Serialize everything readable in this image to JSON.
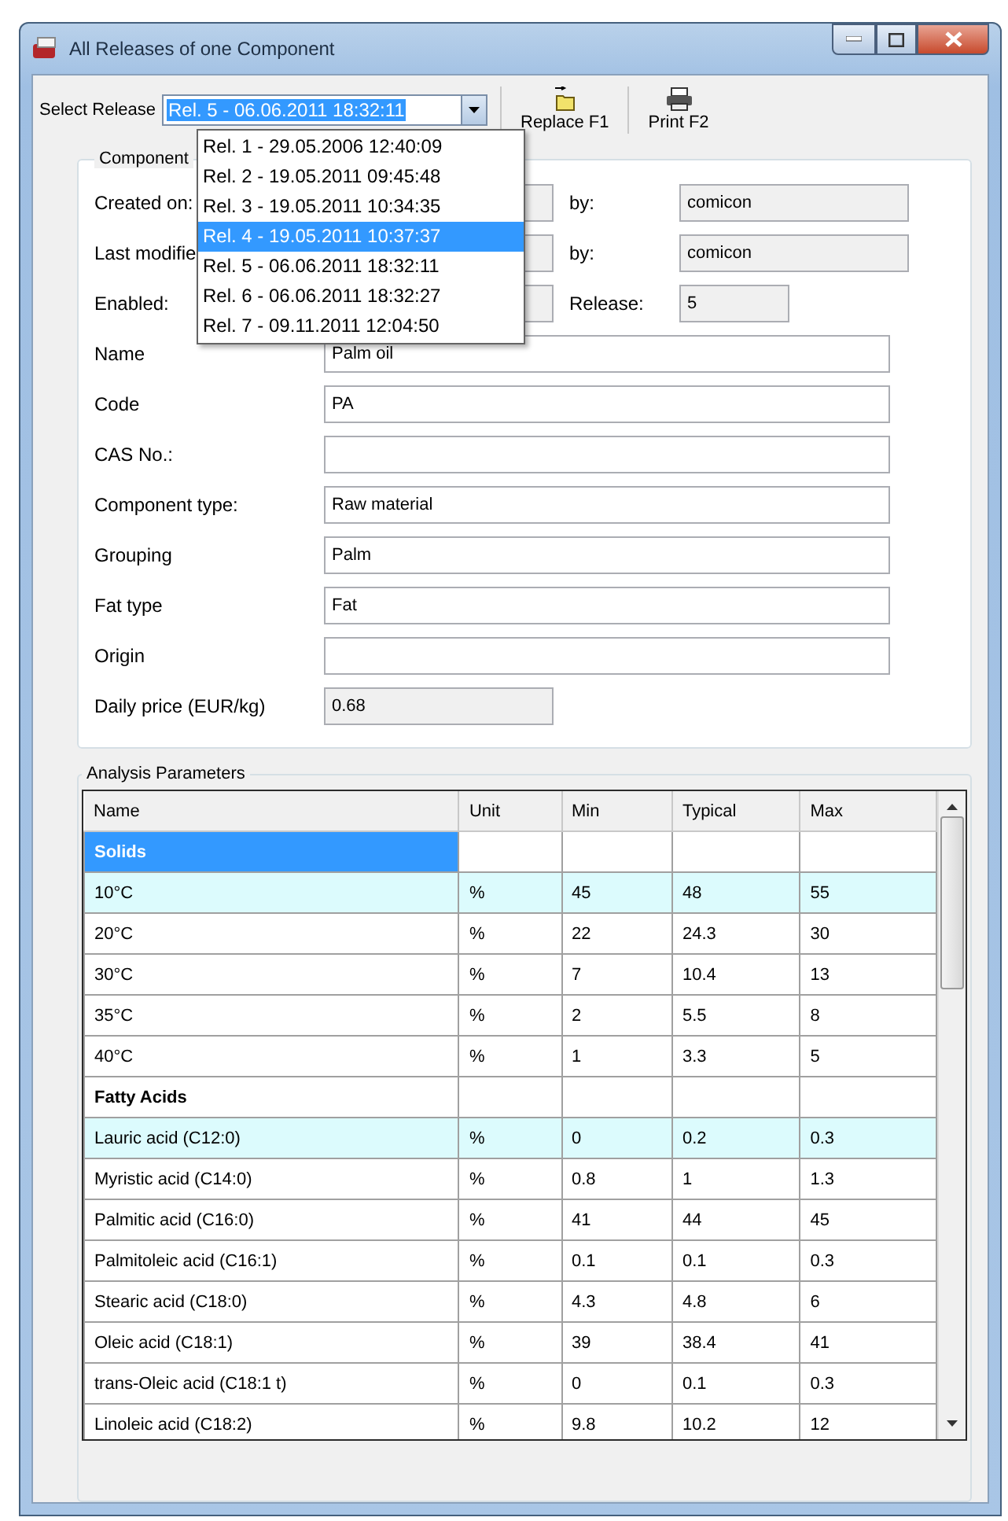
{
  "window": {
    "title": "All Releases of one Component"
  },
  "toolbar": {
    "label": "Select Release",
    "release_value": "Rel. 5 - 06.06.2011 18:32:11",
    "buttons": [
      {
        "kind": "replace",
        "label": "Replace F1"
      },
      {
        "kind": "print",
        "label": "Print F2"
      }
    ]
  },
  "release_dropdown": {
    "options": [
      {
        "label": "Rel. 1 - 29.05.2006 12:40:09",
        "selected": false
      },
      {
        "label": "Rel. 2 - 19.05.2011 09:45:48",
        "selected": false
      },
      {
        "label": "Rel. 3 - 19.05.2011 10:34:35",
        "selected": false
      },
      {
        "label": "Rel. 4 - 19.05.2011 10:37:37",
        "selected": true
      },
      {
        "label": "Rel. 5 - 06.06.2011 18:32:11",
        "selected": false
      },
      {
        "label": "Rel. 6 - 06.06.2011 18:32:27",
        "selected": false
      },
      {
        "label": "Rel. 7 - 09.11.2011 12:04:50",
        "selected": false
      }
    ]
  },
  "component": {
    "title": "Component",
    "meta_rows": [
      {
        "label": "Created on:",
        "by_label": "by:",
        "by_value": "comicon"
      },
      {
        "label": "Last modifie",
        "by_label": "by:",
        "by_value": "comicon"
      },
      {
        "label": "Enabled:",
        "by_label": "Release:",
        "by_value": "5"
      }
    ],
    "fields": [
      {
        "label": "Name",
        "value": "Palm oil",
        "readonly": false
      },
      {
        "label": "Code",
        "value": "PA",
        "readonly": false
      },
      {
        "label": "CAS No.:",
        "readonly": false
      },
      {
        "label": "Component type:",
        "value": "Raw material",
        "readonly": false
      },
      {
        "label": "Grouping",
        "value": "Palm",
        "readonly": false
      },
      {
        "label": "Fat type",
        "value": "Fat",
        "readonly": false
      },
      {
        "label": "Origin",
        "readonly": false
      },
      {
        "label": "Daily price (EUR/kg)",
        "value": "0.68",
        "readonly": true
      }
    ]
  },
  "analysis": {
    "title": "Analysis Parameters",
    "columns": [
      "Name",
      "Unit",
      "Min",
      "Typical",
      "Max"
    ],
    "rows": [
      {
        "kind": "group",
        "name": "Solids",
        "selected": true,
        "highlighted": false
      },
      {
        "kind": "param",
        "name": "10°C",
        "unit": "%",
        "min": "45",
        "typical": "48",
        "max": "55",
        "selected": false,
        "highlighted": true
      },
      {
        "kind": "param",
        "name": "20°C",
        "unit": "%",
        "min": "22",
        "typical": "24.3",
        "max": "30",
        "selected": false,
        "highlighted": false
      },
      {
        "kind": "param",
        "name": "30°C",
        "unit": "%",
        "min": "7",
        "typical": "10.4",
        "max": "13",
        "selected": false,
        "highlighted": false
      },
      {
        "kind": "param",
        "name": "35°C",
        "unit": "%",
        "min": "2",
        "typical": "5.5",
        "max": "8",
        "selected": false,
        "highlighted": false
      },
      {
        "kind": "param",
        "name": "40°C",
        "unit": "%",
        "min": "1",
        "typical": "3.3",
        "max": "5",
        "selected": false,
        "highlighted": false
      },
      {
        "kind": "group",
        "name": "Fatty Acids",
        "selected": false,
        "highlighted": false
      },
      {
        "kind": "param",
        "name": "Lauric acid (C12:0)",
        "unit": "%",
        "min": "0",
        "typical": "0.2",
        "max": "0.3",
        "selected": false,
        "highlighted": true
      },
      {
        "kind": "param",
        "name": "Myristic acid (C14:0)",
        "unit": "%",
        "min": "0.8",
        "typical": "1",
        "max": "1.3",
        "selected": false,
        "highlighted": false
      },
      {
        "kind": "param",
        "name": "Palmitic acid (C16:0)",
        "unit": "%",
        "min": "41",
        "typical": "44",
        "max": "45",
        "selected": false,
        "highlighted": false
      },
      {
        "kind": "param",
        "name": "Palmitoleic acid (C16:1)",
        "unit": "%",
        "min": "0.1",
        "typical": "0.1",
        "max": "0.3",
        "selected": false,
        "highlighted": false
      },
      {
        "kind": "param",
        "name": "Stearic acid (C18:0)",
        "unit": "%",
        "min": "4.3",
        "typical": "4.8",
        "max": "6",
        "selected": false,
        "highlighted": false
      },
      {
        "kind": "param",
        "name": "Oleic acid (C18:1)",
        "unit": "%",
        "min": "39",
        "typical": "38.4",
        "max": "41",
        "selected": false,
        "highlighted": false
      },
      {
        "kind": "param",
        "name": "trans-Oleic acid (C18:1 t)",
        "unit": "%",
        "min": "0",
        "typical": "0.1",
        "max": "0.3",
        "selected": false,
        "highlighted": false
      },
      {
        "kind": "param",
        "name": "Linoleic acid (C18:2)",
        "unit": "%",
        "min": "9.8",
        "typical": "10.2",
        "max": "12",
        "selected": false,
        "highlighted": false
      }
    ]
  }
}
